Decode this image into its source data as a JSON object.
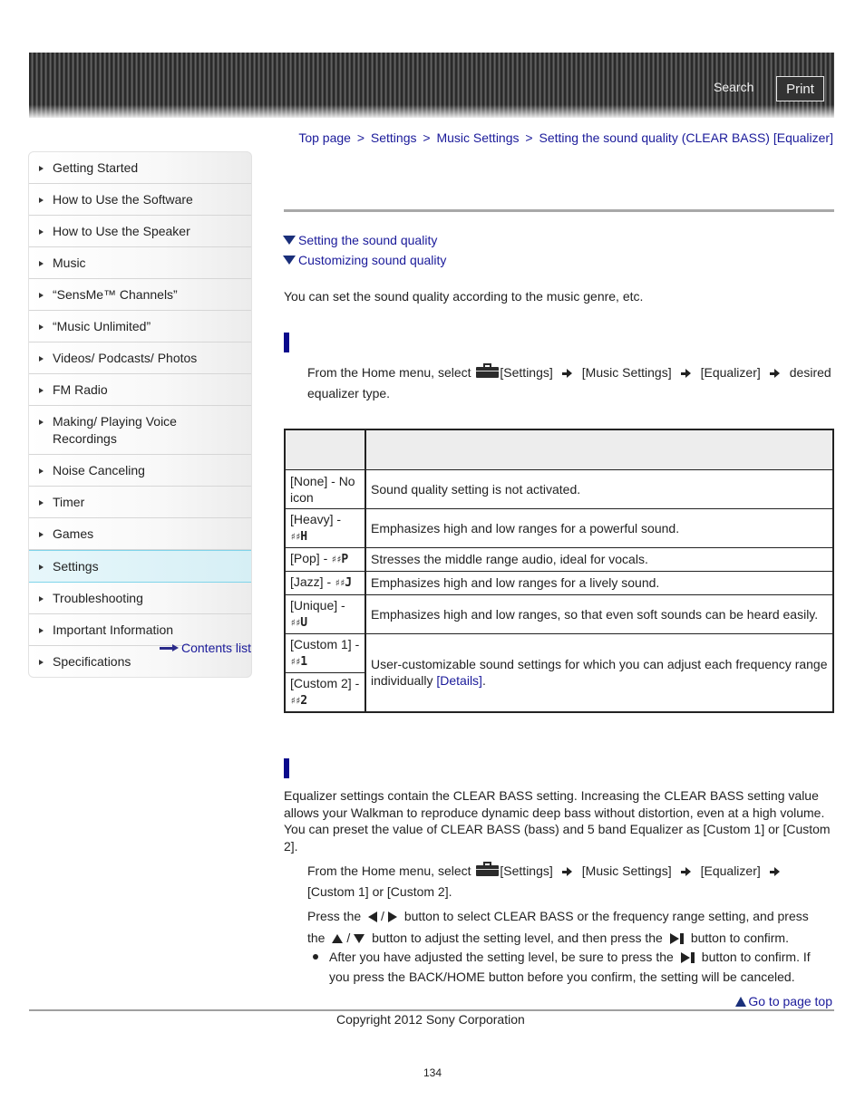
{
  "header": {
    "search_label": "Search",
    "print_label": "Print"
  },
  "breadcrumb": {
    "items": [
      "Top page",
      "Settings",
      "Music Settings",
      "Setting the sound quality (CLEAR BASS) [Equalizer]"
    ],
    "separator": ">"
  },
  "sidebar": {
    "items": [
      {
        "label": "Getting Started",
        "active": false
      },
      {
        "label": "How to Use the Software",
        "active": false
      },
      {
        "label": "How to Use the Speaker",
        "active": false
      },
      {
        "label": "Music",
        "active": false
      },
      {
        "label": "“SensMe™ Channels”",
        "active": false
      },
      {
        "label": "“Music Unlimited”",
        "active": false
      },
      {
        "label": "Videos/ Podcasts/ Photos",
        "active": false
      },
      {
        "label": "FM Radio",
        "active": false
      },
      {
        "label": "Making/ Playing Voice Recordings",
        "active": false
      },
      {
        "label": "Noise Canceling",
        "active": false
      },
      {
        "label": "Timer",
        "active": false
      },
      {
        "label": "Games",
        "active": false
      },
      {
        "label": "Settings",
        "active": true
      },
      {
        "label": "Troubleshooting",
        "active": false
      },
      {
        "label": "Important Information",
        "active": false
      },
      {
        "label": "Specifications",
        "active": false
      }
    ],
    "contents_list_label": "Contents list"
  },
  "main": {
    "toc": [
      "Setting the sound quality",
      "Customizing sound quality"
    ],
    "intro": "You can set the sound quality according to the music genre, etc.",
    "section1": {
      "step_prefix": "From the Home menu, select",
      "step_settings": "[Settings]",
      "step_music_settings": "[Music Settings]",
      "step_equalizer": "[Equalizer]",
      "step_desired": "desired",
      "step_tail": "equalizer type."
    },
    "table": {
      "rows": [
        {
          "name": "[None] - No icon",
          "glyph": "",
          "description": "Sound quality setting is not activated."
        },
        {
          "name": "[Heavy] -",
          "glyph": "H",
          "description": "Emphasizes high and low ranges for a powerful sound."
        },
        {
          "name": "[Pop] -",
          "glyph": "P",
          "description": "Stresses the middle range audio, ideal for vocals."
        },
        {
          "name": "[Jazz] -",
          "glyph": "J",
          "description": "Emphasizes high and low ranges for a lively sound."
        },
        {
          "name": "[Unique] -",
          "glyph": "U",
          "description": "Emphasizes high and low ranges, so that even soft sounds can be heard easily."
        },
        {
          "name": "[Custom 1] -",
          "glyph": "1",
          "description": "User-customizable sound settings for which you can adjust each frequency range individually"
        },
        {
          "name": "[Custom 2] -",
          "glyph": "2",
          "description": ""
        }
      ],
      "details_link": "[Details]",
      "details_suffix": ".",
      "eq_bars_glyph": "♯♯"
    },
    "section2": {
      "paragraph": "Equalizer settings contain the CLEAR BASS setting. Increasing the CLEAR BASS setting value allows your Walkman to reproduce dynamic deep bass without distortion, even at a high volume. You can preset the value of CLEAR BASS (bass) and 5 band Equalizer as [Custom 1] or [Custom 2].",
      "step1_prefix": "From the Home menu, select",
      "step1_settings": "[Settings]",
      "step1_music_settings": "[Music Settings]",
      "step1_equalizer": "[Equalizer]",
      "step1_tail": "[Custom 1] or [Custom 2].",
      "step2_a": "Press the",
      "step2_slash": "/",
      "step2_b": "button to select CLEAR BASS or the frequency range setting, and press",
      "step2_c": "the",
      "step2_d": "button to adjust the setting level, and then press the",
      "step2_e": "button to confirm.",
      "note_a": "After you have adjusted the setting level, be sure to press the",
      "note_b": "button to confirm. If you press the BACK/HOME button before you confirm, the setting will be canceled."
    }
  },
  "footer": {
    "go_to_top_label": "Go to page top",
    "copyright": "Copyright 2012 Sony Corporation",
    "page_number": "134"
  }
}
